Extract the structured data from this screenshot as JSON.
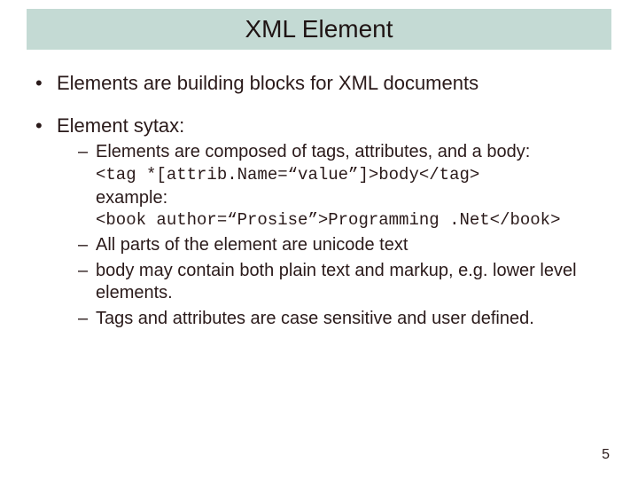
{
  "title": "XML Element",
  "bullet1": "Elements are building blocks for XML documents",
  "bullet2": "Element sytax:",
  "sub1": "Elements are composed of tags, attributes, and a body:",
  "code1": "<tag *[attrib.Name=“value”]>body</tag>",
  "example_label": "example:",
  "code2": "<book author=“Prosise”>Programming .Net</book>",
  "sub2": "All parts of the element are unicode text",
  "sub3": "body may contain both plain text and markup, e.g. lower level elements.",
  "sub4": "Tags and attributes are case sensitive and user defined.",
  "page_number": "5"
}
